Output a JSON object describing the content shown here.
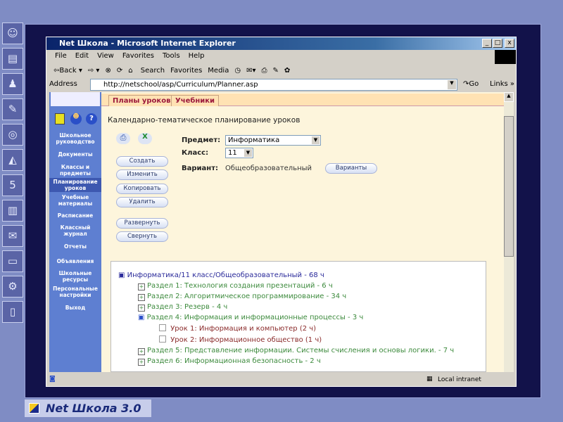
{
  "window": {
    "title": "Net Школа - Microsoft Internet Explorer",
    "min": "_",
    "max": "□",
    "close": "x"
  },
  "menu": [
    "File",
    "Edit",
    "View",
    "Favorites",
    "Tools",
    "Help"
  ],
  "toolbar": {
    "back": "⇦Back ▾",
    "forward": "⇨ ▾",
    "search": "Search",
    "favorites": "Favorites",
    "media": "Media"
  },
  "address": {
    "label": "Address",
    "url": "http://netschool/asp/Curriculum/Planner.asp",
    "go": "Go",
    "links": "Links »"
  },
  "sidebar": [
    "Школьное руководство",
    "Документы",
    "Классы и предметы",
    "Планирование уроков",
    "Учебные материалы",
    "Расписание",
    "Классный журнал",
    "Отчеты",
    "Объявления",
    "Школьные ресурсы",
    "Персональные настройки",
    "Выход"
  ],
  "tabs": [
    "Планы уроков",
    "Учебники"
  ],
  "heading": "Календарно-тематическое планирование уроков",
  "actions": [
    "Создать",
    "Изменить",
    "Копировать",
    "Удалить",
    "Развернуть",
    "Свернуть"
  ],
  "form": {
    "subject_label": "Предмет:",
    "subject_value": "Информатика",
    "class_label": "Класс:",
    "class_value": "11",
    "variant_label": "Вариант:",
    "variant_value": "Общеобразовательный",
    "variants_button": "Варианты"
  },
  "tree": {
    "root": "Информатика/11 класс/Общеобразовательный - 68 ч",
    "sections": [
      "Раздел 1: Технология создания презентаций - 6 ч",
      "Раздел 2: Алгоритмическое программирование - 34 ч",
      "Раздел 3: Резерв - 4 ч",
      "Раздел 4: Информация и информационные процессы - 3 ч"
    ],
    "lessons": [
      "Урок 1: Информация и компьютер (2 ч)",
      "Урок 2: Информационное общество (1 ч)"
    ],
    "sections2": [
      "Раздел 5: Представление информации. Системы счисления и основы логики. - 7 ч",
      "Раздел 6: Информационная безопасность - 2 ч"
    ]
  },
  "status": {
    "zone": "Local intranet"
  },
  "footer": "Net Школа 3.0",
  "colors": {
    "section": "#3c8a3c",
    "lesson": "#8a2a2a",
    "root": "#2a2a9a"
  }
}
